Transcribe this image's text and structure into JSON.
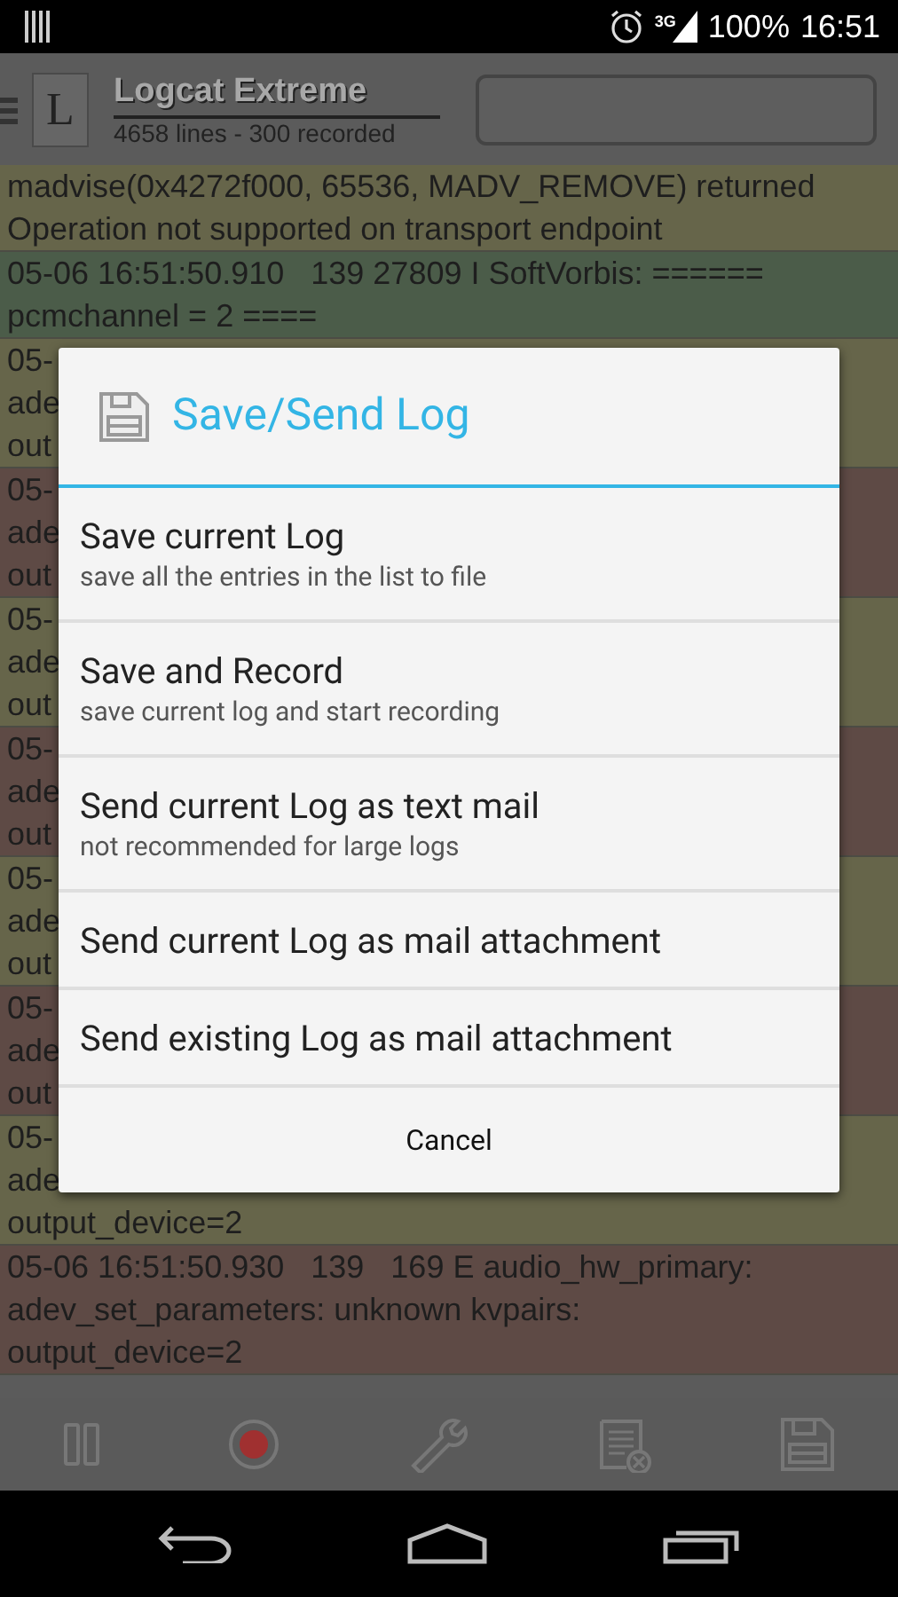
{
  "status_bar": {
    "network": "3G",
    "battery": "100%",
    "time": "16:51"
  },
  "app_bar": {
    "logo_letter": "L",
    "title": "Logcat Extreme",
    "subtitle": "4658 lines - 300 recorded"
  },
  "log": [
    {
      "color": "#66654a",
      "lines": [
        "madvise(0x4272f000, 65536, MADV_REMOVE) returned",
        "Operation not supported on transport endpoint"
      ]
    },
    {
      "color": "#4b5c49",
      "lines": [
        "05-06 16:51:50.910   139 27809 I SoftVorbis: ======",
        "pcmchannel = 2 ===="
      ]
    },
    {
      "color": "#66654a",
      "lines": [
        "05-",
        "ade",
        "out"
      ]
    },
    {
      "color": "#5e4a45",
      "lines": [
        "05-",
        "ade",
        "out"
      ]
    },
    {
      "color": "#66654a",
      "lines": [
        "05-",
        "ade",
        "out"
      ]
    },
    {
      "color": "#5e4a45",
      "lines": [
        "05-",
        "ade",
        "out"
      ]
    },
    {
      "color": "#66654a",
      "lines": [
        "05-",
        "ade",
        "out"
      ]
    },
    {
      "color": "#5e4a45",
      "lines": [
        "05-",
        "ade",
        "out"
      ]
    },
    {
      "color": "#66654a",
      "lines": [
        "05-",
        "ade",
        "output_device=2"
      ]
    },
    {
      "color": "#5e4a45",
      "lines": [
        "05-06 16:51:50.930   139   169 E audio_hw_primary:",
        "adev_set_parameters: unknown kvpairs:",
        "output_device=2"
      ]
    }
  ],
  "toolbar": [
    {
      "kind": "pause"
    },
    {
      "kind": "record"
    },
    {
      "kind": "wrench"
    },
    {
      "kind": "clear"
    },
    {
      "kind": "save"
    }
  ],
  "dialog": {
    "title": "Save/Send Log",
    "options": [
      {
        "label": "Save current Log",
        "description": "save all the entries in the list to file"
      },
      {
        "label": "Save and Record",
        "description": "save current log and start recording"
      },
      {
        "label": "Send current Log as text mail",
        "description": "not recommended for large logs"
      },
      {
        "label": "Send current Log as mail attachment"
      },
      {
        "label": "Send existing Log as mail attachment"
      }
    ],
    "cancel": "Cancel"
  }
}
